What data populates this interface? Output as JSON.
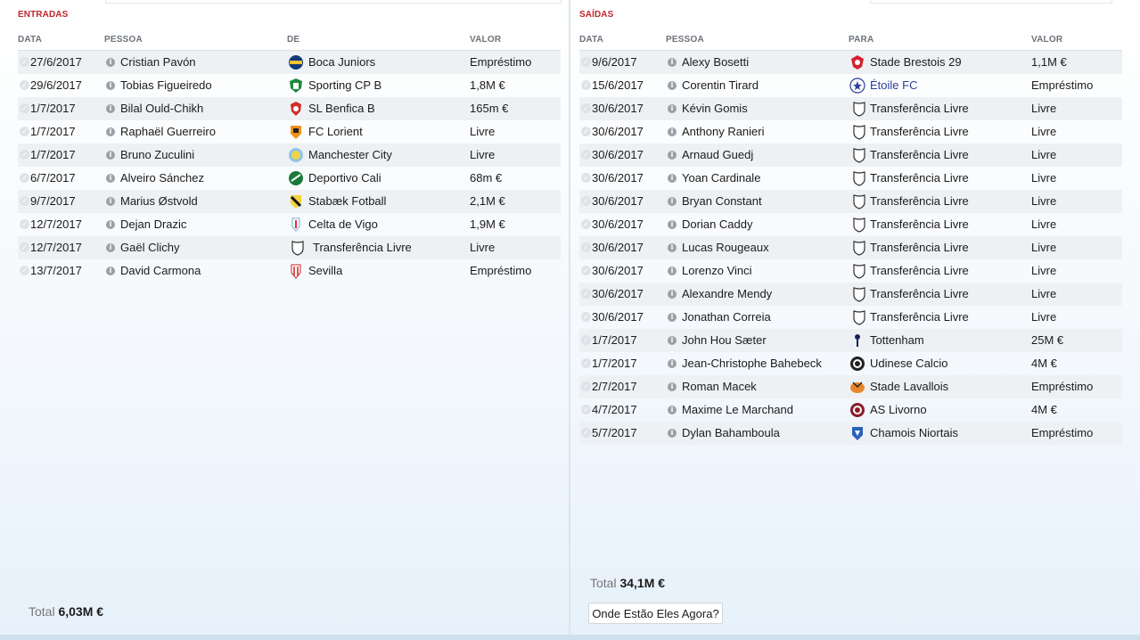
{
  "incoming": {
    "title": "ENTRADAS",
    "headers": {
      "date": "DATA",
      "person": "PESSOA",
      "club": "DE",
      "value": "VALOR"
    },
    "rows": [
      {
        "date": "27/6/2017",
        "person": "Cristian Pavón",
        "club": "Boca Juniors",
        "value": "Empréstimo",
        "crest": "boca-juniors-crest"
      },
      {
        "date": "29/6/2017",
        "person": "Tobias Figueiredo",
        "club": "Sporting CP B",
        "value": "1,8M €",
        "crest": "sporting-cp-crest"
      },
      {
        "date": "1/7/2017",
        "person": "Bilal Ould-Chikh",
        "club": "SL Benfica B",
        "value": "165m €",
        "crest": "benfica-crest"
      },
      {
        "date": "1/7/2017",
        "person": "Raphaël Guerreiro",
        "club": "FC Lorient",
        "value": "Livre",
        "crest": "fc-lorient-crest"
      },
      {
        "date": "1/7/2017",
        "person": "Bruno Zuculini",
        "club": "Manchester City",
        "value": "Livre",
        "crest": "manchester-city-crest"
      },
      {
        "date": "6/7/2017",
        "person": "Alveiro Sánchez",
        "club": "Deportivo Cali",
        "value": "68m €",
        "crest": "deportivo-cali-crest"
      },
      {
        "date": "9/7/2017",
        "person": "Marius Østvold",
        "club": "Stabæk Fotball",
        "value": "2,1M €",
        "crest": "stabaek-crest"
      },
      {
        "date": "12/7/2017",
        "person": "Dejan Drazic",
        "club": "Celta de Vigo",
        "value": "1,9M €",
        "crest": "celta-vigo-crest"
      },
      {
        "date": "12/7/2017",
        "person": "Gaël Clichy",
        "club": "Transferência Livre",
        "value": "Livre",
        "crest": "free-transfer-shield-icon"
      },
      {
        "date": "13/7/2017",
        "person": "David Carmona",
        "club": "Sevilla",
        "value": "Empréstimo",
        "crest": "sevilla-crest"
      }
    ],
    "total_label": "Total",
    "total_value": "6,03M €"
  },
  "outgoing": {
    "title": "SAÍDAS",
    "headers": {
      "date": "DATA",
      "person": "PESSOA",
      "club": "PARA",
      "value": "VALOR"
    },
    "rows": [
      {
        "date": "9/6/2017",
        "person": "Alexy Bosetti",
        "club": "Stade Brestois 29",
        "value": "1,1M €",
        "crest": "stade-brestois-crest"
      },
      {
        "date": "15/6/2017",
        "person": "Corentin Tirard",
        "club": "Étoile FC",
        "value": "Empréstimo",
        "crest": "etoile-fc-crest",
        "link": true
      },
      {
        "date": "30/6/2017",
        "person": "Kévin Gomis",
        "club": "Transferência Livre",
        "value": "Livre",
        "crest": "free-transfer-shield-icon"
      },
      {
        "date": "30/6/2017",
        "person": "Anthony Ranieri",
        "club": "Transferência Livre",
        "value": "Livre",
        "crest": "free-transfer-shield-icon"
      },
      {
        "date": "30/6/2017",
        "person": "Arnaud Guedj",
        "club": "Transferência Livre",
        "value": "Livre",
        "crest": "free-transfer-shield-icon"
      },
      {
        "date": "30/6/2017",
        "person": "Yoan Cardinale",
        "club": "Transferência Livre",
        "value": "Livre",
        "crest": "free-transfer-shield-icon"
      },
      {
        "date": "30/6/2017",
        "person": "Bryan Constant",
        "club": "Transferência Livre",
        "value": "Livre",
        "crest": "free-transfer-shield-icon"
      },
      {
        "date": "30/6/2017",
        "person": "Dorian Caddy",
        "club": "Transferência Livre",
        "value": "Livre",
        "crest": "free-transfer-shield-icon"
      },
      {
        "date": "30/6/2017",
        "person": "Lucas Rougeaux",
        "club": "Transferência Livre",
        "value": "Livre",
        "crest": "free-transfer-shield-icon"
      },
      {
        "date": "30/6/2017",
        "person": "Lorenzo Vinci",
        "club": "Transferência Livre",
        "value": "Livre",
        "crest": "free-transfer-shield-icon"
      },
      {
        "date": "30/6/2017",
        "person": "Alexandre Mendy",
        "club": "Transferência Livre",
        "value": "Livre",
        "crest": "free-transfer-shield-icon"
      },
      {
        "date": "30/6/2017",
        "person": "Jonathan Correia",
        "club": "Transferência Livre",
        "value": "Livre",
        "crest": "free-transfer-shield-icon"
      },
      {
        "date": "1/7/2017",
        "person": "John Hou Sæter",
        "club": "Tottenham",
        "value": "25M €",
        "crest": "tottenham-crest"
      },
      {
        "date": "1/7/2017",
        "person": "Jean-Christophe Bahebeck",
        "club": "Udinese Calcio",
        "value": "4M €",
        "crest": "udinese-crest"
      },
      {
        "date": "2/7/2017",
        "person": "Roman Macek",
        "club": "Stade Lavallois",
        "value": "Empréstimo",
        "crest": "stade-lavallois-crest"
      },
      {
        "date": "4/7/2017",
        "person": "Maxime Le Marchand",
        "club": "AS Livorno",
        "value": "4M €",
        "crest": "as-livorno-crest"
      },
      {
        "date": "5/7/2017",
        "person": "Dylan Bahamboula",
        "club": "Chamois Niortais",
        "value": "Empréstimo",
        "crest": "chamois-niortais-crest"
      }
    ],
    "total_label": "Total",
    "total_value": "34,1M €",
    "button_label": "Onde Estão Eles Agora?"
  },
  "colors": {
    "section_title": "#c0262d",
    "row_shade": "#eef1f4",
    "link_club": "#2a3f9a"
  }
}
